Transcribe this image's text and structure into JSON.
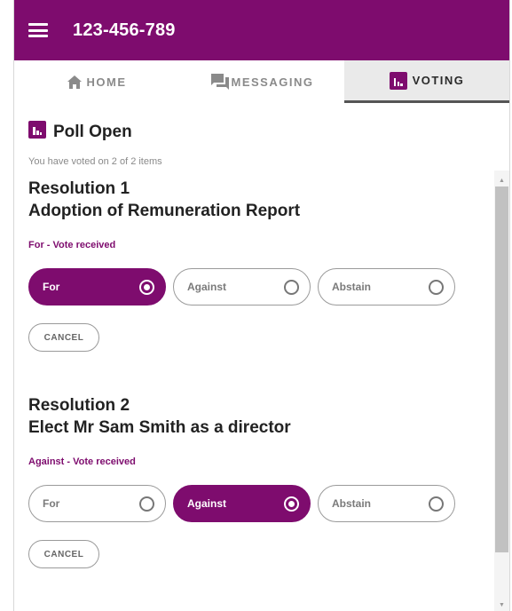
{
  "header": {
    "title": "123-456-789"
  },
  "tabs": [
    {
      "label": "HOME",
      "icon": "home-icon",
      "active": false
    },
    {
      "label": "MESSAGING",
      "icon": "messaging-icon",
      "active": false
    },
    {
      "label": "VOTING",
      "icon": "voting-icon",
      "active": true
    }
  ],
  "poll": {
    "title": "Poll Open",
    "voted_text": "You have voted on 2 of 2 items"
  },
  "resolutions": [
    {
      "title_line1": "Resolution 1",
      "title_line2": "Adoption of Remuneration Report",
      "status": "For - Vote received",
      "options": [
        "For",
        "Against",
        "Abstain"
      ],
      "selected": "For",
      "cancel_label": "CANCEL"
    },
    {
      "title_line1": "Resolution 2",
      "title_line2": "Elect Mr Sam Smith as a director",
      "status": "Against - Vote received",
      "options": [
        "For",
        "Against",
        "Abstain"
      ],
      "selected": "Against",
      "cancel_label": "CANCEL"
    }
  ],
  "colors": {
    "brand": "#7e0c6e",
    "active_tab_bg": "#eaeaea"
  }
}
